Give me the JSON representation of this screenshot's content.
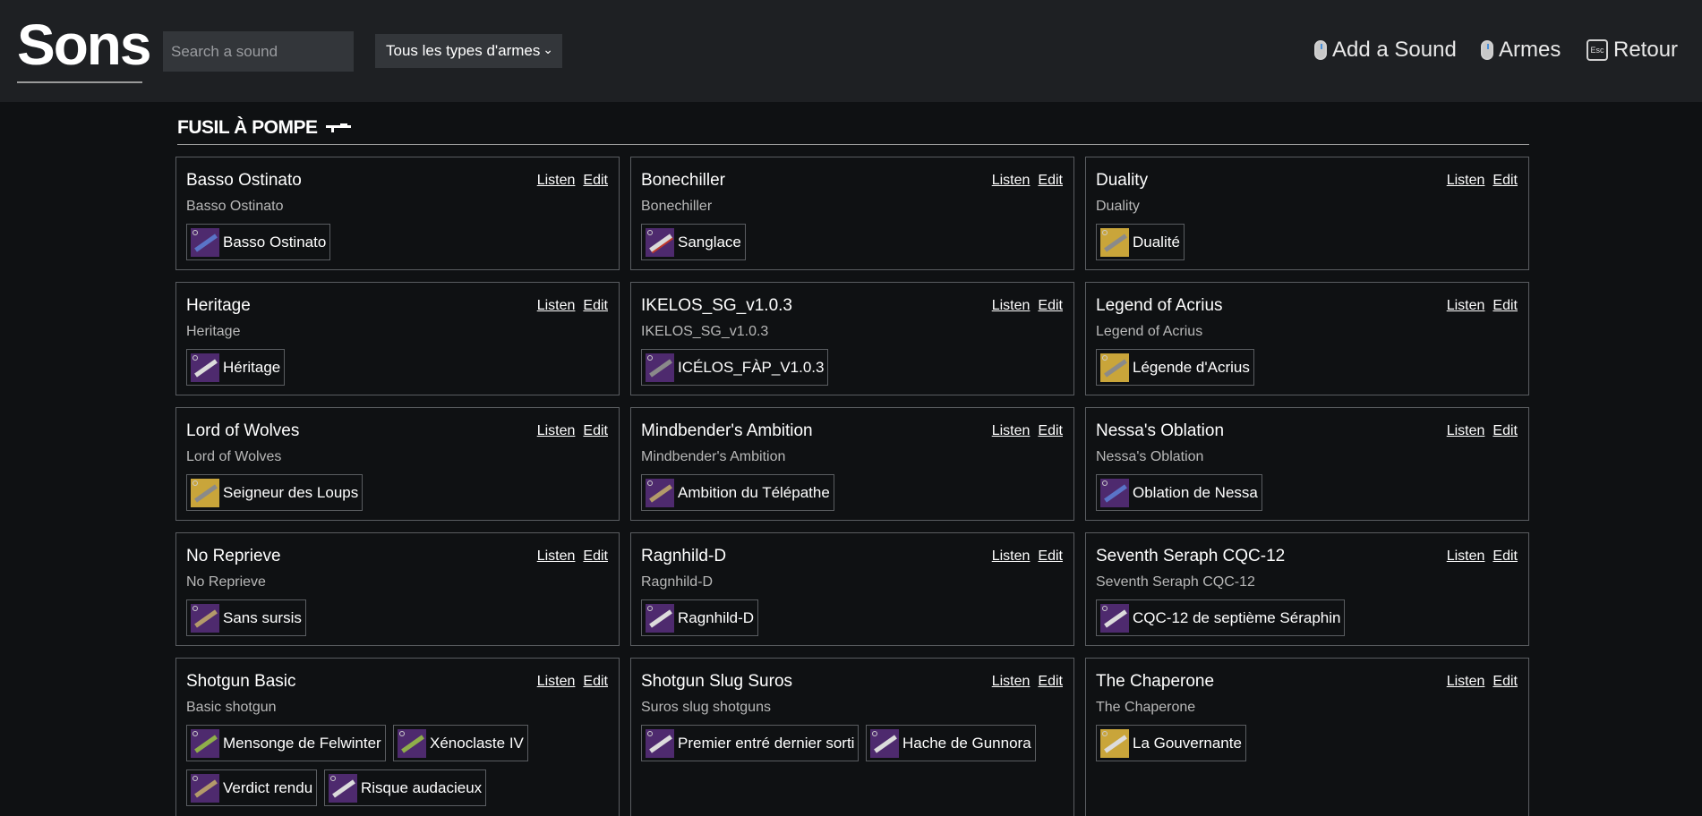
{
  "header": {
    "logo": "Sons",
    "search_placeholder": "Search a sound",
    "weapon_filter": "Tous les types d'armes",
    "nav": {
      "add_sound": "Add a Sound",
      "armes": "Armes",
      "esc_key": "Esc",
      "retour": "Retour"
    }
  },
  "section": {
    "title": "FUSIL À POMPE"
  },
  "cards": [
    {
      "title": "Basso Ostinato",
      "subtitle": "Basso Ostinato",
      "listen": "Listen",
      "edit": "Edit",
      "weapons": [
        {
          "name": "Basso Ostinato",
          "rarity": "purple",
          "gun": "blue"
        }
      ]
    },
    {
      "title": "Bonechiller",
      "subtitle": "Bonechiller",
      "listen": "Listen",
      "edit": "Edit",
      "weapons": [
        {
          "name": "Sanglace",
          "rarity": "purple",
          "gun": "red"
        }
      ]
    },
    {
      "title": "Duality",
      "subtitle": "Duality",
      "listen": "Listen",
      "edit": "Edit",
      "weapons": [
        {
          "name": "Dualité",
          "rarity": "gold",
          "gun": "dark"
        }
      ]
    },
    {
      "title": "Heritage",
      "subtitle": "Heritage",
      "listen": "Listen",
      "edit": "Edit",
      "weapons": [
        {
          "name": "Héritage",
          "rarity": "purple",
          "gun": "light"
        }
      ]
    },
    {
      "title": "IKELOS_SG_v1.0.3",
      "subtitle": "IKELOS_SG_v1.0.3",
      "listen": "Listen",
      "edit": "Edit",
      "weapons": [
        {
          "name": "ICÉLOS_FÀP_V1.0.3",
          "rarity": "purple",
          "gun": "dark"
        }
      ]
    },
    {
      "title": "Legend of Acrius",
      "subtitle": "Legend of Acrius",
      "listen": "Listen",
      "edit": "Edit",
      "weapons": [
        {
          "name": "Légende d'Acrius",
          "rarity": "gold",
          "gun": "dark"
        }
      ]
    },
    {
      "title": "Lord of Wolves",
      "subtitle": "Lord of Wolves",
      "listen": "Listen",
      "edit": "Edit",
      "weapons": [
        {
          "name": "Seigneur des Loups",
          "rarity": "gold",
          "gun": "dark"
        }
      ]
    },
    {
      "title": "Mindbender's Ambition",
      "subtitle": "Mindbender's Ambition",
      "listen": "Listen",
      "edit": "Edit",
      "weapons": [
        {
          "name": "Ambition du Télépathe",
          "rarity": "purple",
          "gun": "tan"
        }
      ]
    },
    {
      "title": "Nessa's Oblation",
      "subtitle": "Nessa's Oblation",
      "listen": "Listen",
      "edit": "Edit",
      "weapons": [
        {
          "name": "Oblation de Nessa",
          "rarity": "purple",
          "gun": "blue"
        }
      ]
    },
    {
      "title": "No Reprieve",
      "subtitle": "No Reprieve",
      "listen": "Listen",
      "edit": "Edit",
      "weapons": [
        {
          "name": "Sans sursis",
          "rarity": "purple",
          "gun": "tan"
        }
      ]
    },
    {
      "title": "Ragnhild-D",
      "subtitle": "Ragnhild-D",
      "listen": "Listen",
      "edit": "Edit",
      "weapons": [
        {
          "name": "Ragnhild-D",
          "rarity": "purple",
          "gun": "light"
        }
      ]
    },
    {
      "title": "Seventh Seraph CQC-12",
      "subtitle": "Seventh Seraph CQC-12",
      "listen": "Listen",
      "edit": "Edit",
      "weapons": [
        {
          "name": "CQC-12 de septième Séraphin",
          "rarity": "purple",
          "gun": "light"
        }
      ]
    },
    {
      "title": "Shotgun Basic",
      "subtitle": "Basic shotgun",
      "listen": "Listen",
      "edit": "Edit",
      "weapons": [
        {
          "name": "Mensonge de Felwinter",
          "rarity": "purple",
          "gun": "green"
        },
        {
          "name": "Xénoclaste IV",
          "rarity": "purple",
          "gun": "green"
        },
        {
          "name": "Verdict rendu",
          "rarity": "purple",
          "gun": "tan"
        },
        {
          "name": "Risque audacieux",
          "rarity": "purple",
          "gun": "light"
        }
      ]
    },
    {
      "title": "Shotgun Slug Suros",
      "subtitle": "Suros slug shotguns",
      "listen": "Listen",
      "edit": "Edit",
      "weapons": [
        {
          "name": "Premier entré dernier sorti",
          "rarity": "purple",
          "gun": "light"
        },
        {
          "name": "Hache de Gunnora",
          "rarity": "purple",
          "gun": "light"
        }
      ]
    },
    {
      "title": "The Chaperone",
      "subtitle": "The Chaperone",
      "listen": "Listen",
      "edit": "Edit",
      "weapons": [
        {
          "name": "La Gouvernante",
          "rarity": "gold",
          "gun": "light"
        }
      ]
    }
  ]
}
